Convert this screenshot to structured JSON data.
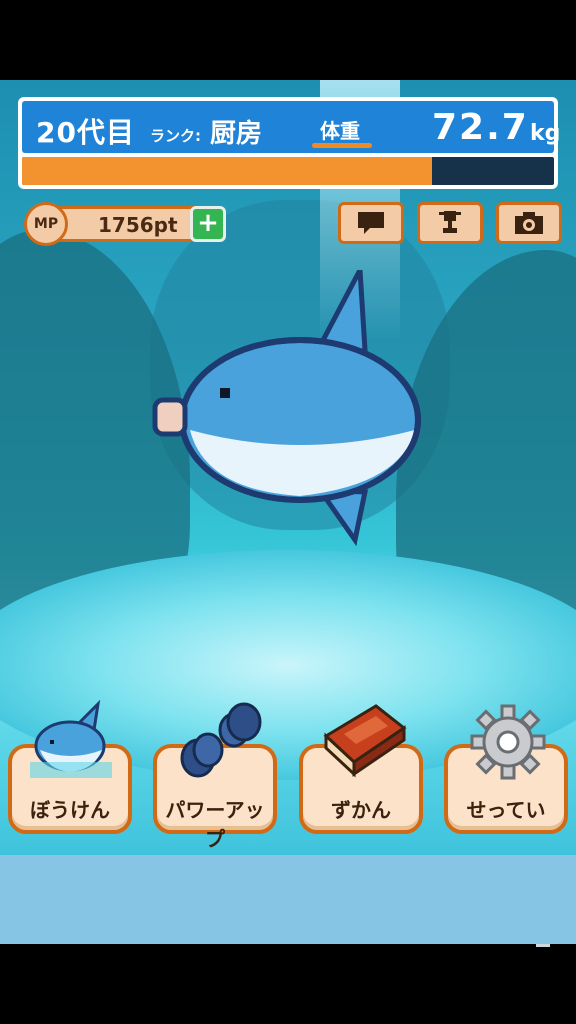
{
  "status": {
    "generation": "20代目",
    "rank_label": "ランク:",
    "rank_value": "厨房",
    "weight_label": "体重",
    "weight_value": "72.7",
    "weight_unit": "kg",
    "progress_fraction": 0.77,
    "progress_color": "#f39330"
  },
  "mp": {
    "badge": "MP",
    "value": "1756pt",
    "plus": "+"
  },
  "toolbar": {
    "icons": [
      "chat-icon",
      "trophy-icon",
      "camera-icon"
    ]
  },
  "menu": {
    "items": [
      {
        "label": "ぼうけん",
        "icon": "sunfish-icon"
      },
      {
        "label": "パワーアップ",
        "icon": "dumbbell-icon"
      },
      {
        "label": "ずかん",
        "icon": "book-icon"
      },
      {
        "label": "せってい",
        "icon": "gear-icon"
      }
    ]
  },
  "colors": {
    "accent": "#d06a16",
    "status_blue": "#1f83d8",
    "button_bg": "#f3cba7"
  }
}
